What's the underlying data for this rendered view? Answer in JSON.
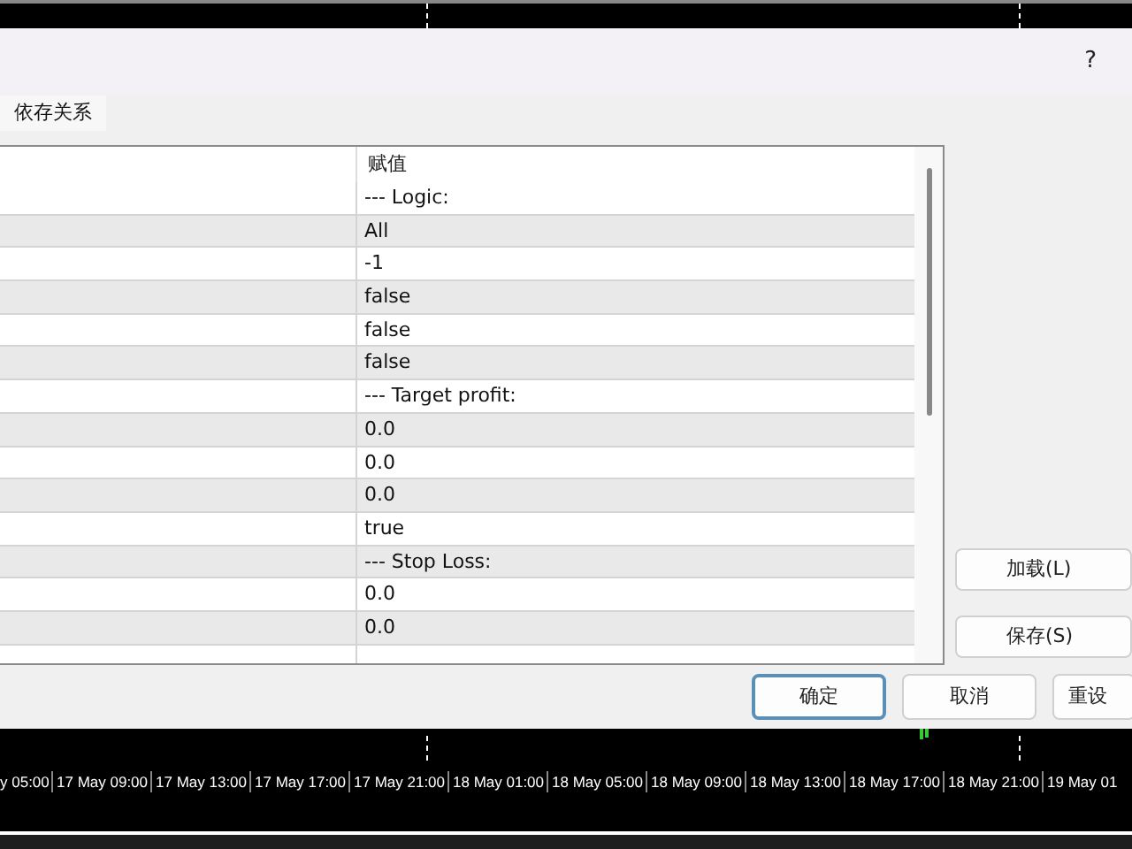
{
  "dialog": {
    "help": "?",
    "tabs": [
      {
        "label": "依存关系",
        "selected": true
      }
    ],
    "table": {
      "columns": [
        "",
        "赋值"
      ],
      "rows": [
        {
          "value": "--- Logic:"
        },
        {
          "value": "All"
        },
        {
          "value": "-1"
        },
        {
          "value": "false"
        },
        {
          "value": "false"
        },
        {
          "value": "false"
        },
        {
          "value": "--- Target profit:"
        },
        {
          "value": "0.0"
        },
        {
          "value": "0.0"
        },
        {
          "value": "0.0"
        },
        {
          "value": "true"
        },
        {
          "value": "--- Stop Loss:"
        },
        {
          "value": "0.0"
        },
        {
          "value": "0.0"
        }
      ]
    },
    "side_buttons": [
      "加载(L)",
      "保存(S)"
    ],
    "buttons": [
      {
        "label": "确定",
        "default": true
      },
      {
        "label": "取消",
        "default": false
      },
      {
        "label": "重设",
        "default": false
      }
    ]
  },
  "chart": {
    "time_labels": [
      "y 05:00",
      "17 May 09:00",
      "17 May 13:00",
      "17 May 17:00",
      "17 May 21:00",
      "18 May 01:00",
      "18 May 05:00",
      "18 May 09:00",
      "18 May 13:00",
      "18 May 17:00",
      "18 May 21:00",
      "19 May 01"
    ]
  }
}
